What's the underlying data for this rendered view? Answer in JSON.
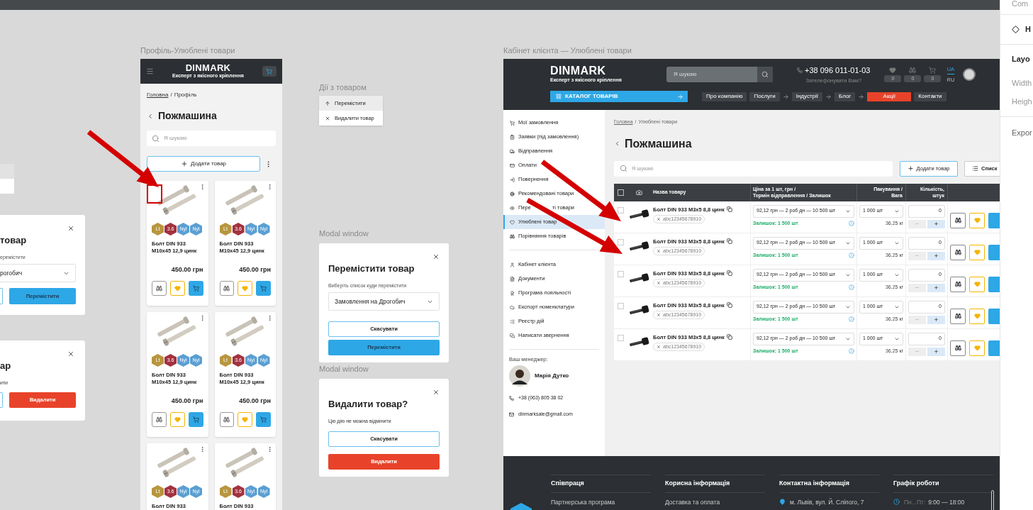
{
  "right_panel": {
    "top_label": "Com",
    "component_label": "H",
    "section_label": "Layo",
    "width_label": "Width",
    "height_label": "Heigh",
    "export_label": "Expor"
  },
  "partial_menu": {
    "items": [
      {
        "selected": true
      },
      {
        "selected": false
      }
    ]
  },
  "partial_move_modal": {
    "title": "товар",
    "label": "еремістити",
    "select": "рогобич",
    "confirm": "Перемістити"
  },
  "partial_delete_modal": {
    "title": "ар",
    "message": "ити",
    "confirm": "Видалити"
  },
  "mobile": {
    "frame_label": "Профіль-Улюблені товари",
    "logo": "DINMARK",
    "tagline": "Експерт з якісного кріплення",
    "breadcrumb": {
      "items": [
        "Головна",
        "Профіль"
      ],
      "separator": "/"
    },
    "title": "Пожмашина",
    "search_placeholder": "Я шукаю",
    "add_button": "Додати товар",
    "cards": [
      {
        "badges": [
          {
            "label": "Lt",
            "color": "#b8963e"
          },
          {
            "label": "3.6",
            "color": "#a3323f"
          },
          {
            "label": "Nyl",
            "color": "#5b9fd3"
          },
          {
            "label": "Nyl",
            "color": "#5b9fd3"
          }
        ],
        "name": "Болт DIN 933 M10x45 12,9 цинк",
        "price": "450.00 грн",
        "favorite": true
      },
      {
        "badges": [
          {
            "label": "Lt",
            "color": "#b8963e"
          },
          {
            "label": "3.6",
            "color": "#a3323f"
          },
          {
            "label": "Nyl",
            "color": "#5b9fd3"
          },
          {
            "label": "Nyl",
            "color": "#5b9fd3"
          }
        ],
        "name": "Болт DIN 933 M10x45 12,9 цинк",
        "price": "450.00 грн",
        "favorite": true
      },
      {
        "badges": [
          {
            "label": "Lt",
            "color": "#b8963e"
          },
          {
            "label": "3.6",
            "color": "#a3323f"
          },
          {
            "label": "Nyl",
            "color": "#5b9fd3"
          },
          {
            "label": "Nyl",
            "color": "#5b9fd3"
          }
        ],
        "name": "Болт DIN 933 M10x45 12,9 цинк",
        "price": "450.00 грн",
        "favorite": true
      },
      {
        "badges": [
          {
            "label": "Lt",
            "color": "#b8963e"
          },
          {
            "label": "3.6",
            "color": "#a3323f"
          },
          {
            "label": "Nyl",
            "color": "#5b9fd3"
          },
          {
            "label": "Nyl",
            "color": "#5b9fd3"
          }
        ],
        "name": "Болт DIN 933 M10x45 12,9 цинк",
        "price": "450.00 грн",
        "favorite": true
      },
      {
        "badges": [
          {
            "label": "Lt",
            "color": "#b8963e"
          },
          {
            "label": "3.6",
            "color": "#a3323f"
          },
          {
            "label": "Nyl",
            "color": "#5b9fd3"
          },
          {
            "label": "Nyl",
            "color": "#5b9fd3"
          }
        ],
        "name": "Болт DIN 933"
      },
      {
        "badges": [
          {
            "label": "Lt",
            "color": "#b8963e"
          },
          {
            "label": "3.6",
            "color": "#a3323f"
          },
          {
            "label": "Nyl",
            "color": "#5b9fd3"
          },
          {
            "label": "Nyl",
            "color": "#5b9fd3"
          }
        ],
        "name": "Болт DIN 933"
      }
    ]
  },
  "actions_menu": {
    "frame_label": "Дії з товаром",
    "items": [
      {
        "kind": "move",
        "label": "Перемістити",
        "selected": true
      },
      {
        "kind": "delete",
        "label": "Видалити товар",
        "selected": false
      }
    ]
  },
  "move_modal": {
    "frame_label": "Modal window",
    "title": "Перемістити товар",
    "label": "Виберіть список куди перемістити",
    "select": "Замовлення на Дрогобич",
    "cancel": "Скасувати",
    "confirm": "Перемістити"
  },
  "delete_modal": {
    "frame_label": "Modal window",
    "title": "Видалити товар?",
    "message": "Цю дію не можна відмінити",
    "cancel": "Скасувати",
    "confirm": "Видалити"
  },
  "desktop": {
    "frame_label": "Кабінет клієнта — Улюблені товари",
    "header": {
      "logo": "DINMARK",
      "tagline": "Експерт з якісного кріплення",
      "search_placeholder": "Я шукаю",
      "phone": "+38 096 011-01-03",
      "callback": "Зателефонувати Вам?",
      "counters": [
        {
          "kind": "favorites",
          "count": "0"
        },
        {
          "kind": "compare",
          "count": "0"
        },
        {
          "kind": "cart",
          "count": "0"
        }
      ],
      "languages": [
        {
          "label": "UA",
          "selected": true
        },
        {
          "label": "RU",
          "selected": false
        }
      ]
    },
    "nav": {
      "catalog": "КАТАЛОГ ТОВАРІВ",
      "items": [
        {
          "label": "Про компанію",
          "selected": false,
          "submenu": false
        },
        {
          "label": "Послуги",
          "selected": false,
          "submenu": true
        },
        {
          "label": "Індустрії",
          "selected": false,
          "submenu": true
        },
        {
          "label": "Блог",
          "selected": false,
          "submenu": true
        },
        {
          "label": "Акції",
          "selected": true,
          "submenu": false
        },
        {
          "label": "Контакти",
          "selected": false,
          "submenu": false
        }
      ]
    },
    "sidebar": {
      "groups": [
        [
          {
            "label": "Мої замовлення",
            "selected": false
          },
          {
            "label": "Заявки (під замовлення)",
            "selected": false
          },
          {
            "label": "Відправлення",
            "selected": false
          },
          {
            "label": "Оплати",
            "selected": false
          },
          {
            "label": "Повернення",
            "selected": false
          },
          {
            "label": "Рекомендовані товари",
            "selected": false
          },
          {
            "label": "Пере",
            "label_after_cover": "ті товари",
            "selected": false
          },
          {
            "label": "Улюблені товар",
            "selected": true
          },
          {
            "label": "Порівняння товарів",
            "selected": false
          }
        ],
        [
          {
            "label": "Кабінет клієнта",
            "selected": false
          },
          {
            "label": "Документи",
            "selected": false
          },
          {
            "label": "Програма лояльності",
            "selected": false
          },
          {
            "label": "Експорт номенклатури",
            "selected": false
          },
          {
            "label": "Реєстр дій",
            "selected": false
          },
          {
            "label": "Написати звернення",
            "selected": false
          }
        ]
      ],
      "manager_label": "Ваш менеджер:",
      "manager_name": "Марія Дутко",
      "phone": "+38 (063) 805 38 02",
      "email": "dinmarksale@gmail.com"
    },
    "main": {
      "breadcrumb": {
        "items": [
          "Головна",
          "Улюблені товари"
        ],
        "separator": "/"
      },
      "title": "Пожмашина",
      "search_placeholder": "Я шукаю",
      "add_button": "Додати товар",
      "list_button": "Списк"
    },
    "table": {
      "all_checked": false,
      "columns": [
        "Назва товару",
        "Ціна за 1 шт, грн /\nТермін відправлення / Залишок",
        "Пакування /\nВага",
        "Кількість,\nштук"
      ],
      "rows": [
        {
          "checked": false,
          "name": "Болт DIN 933 M3x5 8,8 цинк",
          "article": "abc12345678910",
          "offer": "92,12 грн — 2 роб дн — 10 500 шт",
          "stock": "Залишок: 1 500 шт",
          "package": "1 000 шт",
          "weight": "36,25 кг",
          "quantity": "0",
          "favorite": true
        },
        {
          "checked": false,
          "name": "Болт DIN 933 M3x5 8,8 цинк",
          "article": "abc12345678910",
          "offer": "92,12 грн — 2 роб дн — 10 500 шт",
          "stock": "Залишок: 1 500 шт",
          "package": "1 000 шт",
          "weight": "36,25 кг",
          "quantity": "0",
          "favorite": true
        },
        {
          "checked": false,
          "name": "Болт DIN 933 M3x5 8,8 цинк",
          "article": "abc12345678910",
          "offer": "92,12 грн — 2 роб дн — 10 500 шт",
          "stock": "Залишок: 1 500 шт",
          "package": "1 000 шт",
          "weight": "36,25 кг",
          "quantity": "0",
          "favorite": true
        },
        {
          "checked": false,
          "name": "Болт DIN 933 M3x5 8,8 цинк",
          "article": "abc12345678910",
          "offer": "92,12 грн — 2 роб дн — 10 500 шт",
          "stock": "Залишок: 1 500 шт",
          "package": "1 000 шт",
          "weight": "36,25 кг",
          "quantity": "0",
          "favorite": true
        },
        {
          "checked": false,
          "name": "Болт DIN 933 M3x5 8,8 цинк",
          "article": "abc12345678910",
          "offer": "92,12 грн — 2 роб дн — 10 500 шт",
          "stock": "Залишок: 1 500 шт",
          "package": "1 000 шт",
          "weight": "36,25 кг",
          "quantity": "0",
          "favorite": true
        }
      ]
    },
    "footer": {
      "columns": [
        {
          "title": "Співпраця",
          "items": [
            {
              "kind": "link",
              "label": "Партнерська програма"
            }
          ]
        },
        {
          "title": "Корисна інформація",
          "items": [
            {
              "kind": "link",
              "label": "Доставка та оплата"
            }
          ]
        },
        {
          "title": "Контактна інформація",
          "items": [
            {
              "kind": "address",
              "label": "м. Львів, вул. Й. Сліпого, 7"
            }
          ]
        },
        {
          "title": "Графік роботи",
          "items": [
            {
              "kind": "schedule",
              "prefix": "Пн...Пт:",
              "label": "9:00 — 18:00"
            }
          ]
        }
      ]
    }
  }
}
